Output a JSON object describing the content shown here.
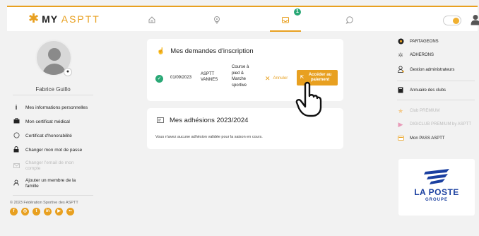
{
  "header": {
    "logo_mark": "✱",
    "logo_text_main": "MY",
    "logo_text_accent": "ASPTT",
    "nav_icons": [
      "home-icon",
      "location-icon",
      "inbox-icon",
      "chat-icon"
    ],
    "active_nav": "inbox-icon",
    "notification_count": "1",
    "theme_toggle": "light",
    "accent_color": "#e8a020"
  },
  "profile": {
    "name": "Fabrice Guillo",
    "menu": [
      {
        "label": "Mes informations personnelles",
        "icon": "info-icon",
        "enabled": true
      },
      {
        "label": "Mon certificat médical",
        "icon": "briefcase-icon",
        "enabled": true
      },
      {
        "label": "Certificat d'honorabilité",
        "icon": "circle-icon",
        "enabled": true
      },
      {
        "label": "Changer mon mot de passe",
        "icon": "lock-icon",
        "enabled": true
      },
      {
        "label": "Changer l'email de mon compte",
        "icon": "email-icon",
        "enabled": false
      },
      {
        "label": "Ajouter un membre de la famille",
        "icon": "add-user-icon",
        "enabled": true
      }
    ],
    "copyright": "© 2023 Fédération Sportive des ASPTT",
    "socials": [
      "facebook-icon",
      "instagram-icon",
      "twitter-icon",
      "linkedin-icon",
      "youtube-icon",
      "flickr-icon"
    ]
  },
  "requests": {
    "title": "Mes demandes d'inscription",
    "row": {
      "status": "validated",
      "date": "01/09/2023",
      "club": "ASPTT VANNES",
      "activity": "Course à pied & Marche sportive",
      "cancel_label": "Annuler",
      "access_label": "Accéder au paiement"
    }
  },
  "memberships": {
    "title": "Mes adhésions 2023/2024",
    "empty_text": "Vous n'avez aucune adhésion validée pour la saison en cours."
  },
  "right_menu": {
    "items_top": [
      {
        "label": "PARTAGEONS",
        "icon": "share-icon",
        "enabled": true
      },
      {
        "label": "ADHERONS",
        "icon": "gear-icon",
        "enabled": true
      },
      {
        "label": "Gestion administrateurs",
        "icon": "admin-icon",
        "enabled": true
      }
    ],
    "items_mid": [
      {
        "label": "Annuaire des clubs",
        "icon": "book-icon",
        "enabled": true
      }
    ],
    "items_bottom": [
      {
        "label": "Club PREMIUM",
        "icon": "star-icon",
        "enabled": false
      },
      {
        "label": "DIGICLUB PREMIUM by ASPTT",
        "icon": "play-icon",
        "enabled": false
      },
      {
        "label": "Mon PASS ASPTT",
        "icon": "pass-icon",
        "enabled": true
      }
    ]
  },
  "sponsor": {
    "name": "LA POSTE",
    "group": "GROUPE"
  }
}
